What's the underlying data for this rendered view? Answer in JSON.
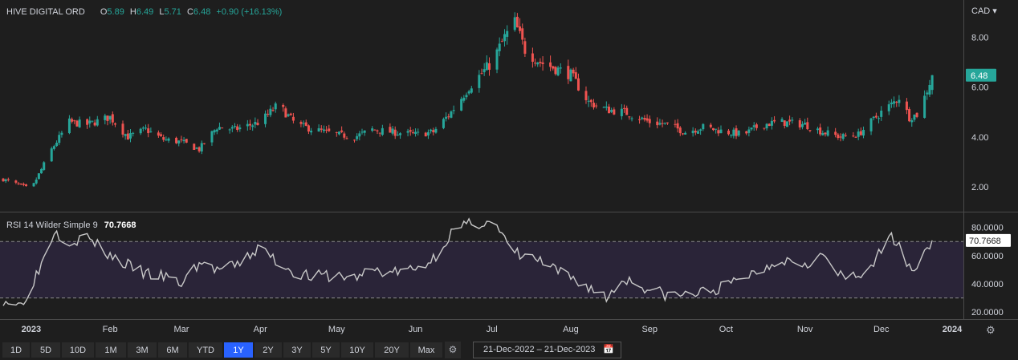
{
  "header": {
    "name": "HIVE DIGITAL ORD",
    "o_label": "O",
    "o_value": "5.89",
    "h_label": "H",
    "h_value": "6.49",
    "l_label": "L",
    "l_value": "5.71",
    "c_label": "C",
    "c_value": "6.48",
    "change": "+0.90 (+16.13%)"
  },
  "currency": "CAD",
  "rsi_header": {
    "label": "RSI 14 Wilder Simple 9",
    "value": "70.7668"
  },
  "colors": {
    "up": "#26a69a",
    "down": "#ef5350",
    "background": "#1e1e1e",
    "rsi_line": "#c8c8c8",
    "accent": "#2962ff"
  },
  "ranges": [
    "1D",
    "5D",
    "10D",
    "1M",
    "3M",
    "6M",
    "YTD",
    "1Y",
    "2Y",
    "3Y",
    "5Y",
    "10Y",
    "20Y",
    "Max"
  ],
  "active_range": "1Y",
  "date_range": "21-Dec-2022  –  21-Dec-2023",
  "icons": {
    "settings": "gear-icon",
    "calendar": "calendar-icon",
    "dropdown": "chevron-down-icon"
  },
  "chart_data": [
    {
      "type": "candlestick",
      "title": "HIVE DIGITAL ORD",
      "x_tick_labels": [
        "2023",
        "Feb",
        "Mar",
        "Apr",
        "May",
        "Jun",
        "Jul",
        "Aug",
        "Sep",
        "Oct",
        "Nov",
        "Dec",
        "2024"
      ],
      "y_tick_labels": [
        "2.00",
        "4.00",
        "6.00",
        "8.00"
      ],
      "ylim": [
        1.0,
        9.5
      ],
      "last_price_label": "6.48",
      "grid": false,
      "x": [
        "2022-12-21",
        "2023-01-01",
        "2023-01-09",
        "2023-01-16",
        "2023-01-23",
        "2023-02-01",
        "2023-02-08",
        "2023-02-15",
        "2023-02-22",
        "2023-03-01",
        "2023-03-08",
        "2023-03-15",
        "2023-03-22",
        "2023-04-01",
        "2023-04-08",
        "2023-04-15",
        "2023-04-22",
        "2023-05-01",
        "2023-05-08",
        "2023-05-15",
        "2023-05-22",
        "2023-06-01",
        "2023-06-08",
        "2023-06-15",
        "2023-06-22",
        "2023-07-01",
        "2023-07-06",
        "2023-07-10",
        "2023-07-14",
        "2023-07-20",
        "2023-08-01",
        "2023-08-08",
        "2023-08-15",
        "2023-08-22",
        "2023-09-01",
        "2023-09-08",
        "2023-09-15",
        "2023-09-22",
        "2023-10-01",
        "2023-10-08",
        "2023-10-15",
        "2023-10-22",
        "2023-11-01",
        "2023-11-08",
        "2023-11-15",
        "2023-11-22",
        "2023-12-01",
        "2023-12-05",
        "2023-12-08",
        "2023-12-12",
        "2023-12-15",
        "2023-12-18",
        "2023-12-21"
      ],
      "close": [
        2.3,
        1.9,
        3.5,
        4.6,
        4.5,
        4.8,
        4.0,
        4.3,
        3.9,
        3.8,
        3.5,
        4.4,
        4.3,
        4.6,
        5.3,
        4.5,
        4.3,
        4.1,
        4.0,
        4.3,
        4.2,
        4.1,
        4.2,
        5.0,
        6.0,
        7.0,
        8.0,
        8.6,
        7.5,
        7.0,
        6.5,
        5.4,
        5.1,
        5.0,
        4.6,
        4.5,
        4.2,
        4.4,
        4.2,
        4.1,
        4.5,
        4.6,
        4.5,
        4.2,
        4.0,
        4.1,
        5.0,
        5.3,
        5.6,
        4.8,
        4.9,
        5.6,
        6.48
      ]
    },
    {
      "type": "line",
      "title": "RSI 14 Wilder Simple 9",
      "series": [
        {
          "name": "RSI 14 Wilder Simple 9"
        }
      ],
      "y_tick_labels": [
        "20.0000",
        "40.0000",
        "60.0000",
        "80.0000"
      ],
      "ylim": [
        15,
        90
      ],
      "bands": [
        30,
        70
      ],
      "last_value_label": "70.7668",
      "x": [
        "2022-12-21",
        "2022-12-28",
        "2023-01-04",
        "2023-01-10",
        "2023-01-16",
        "2023-01-23",
        "2023-02-01",
        "2023-02-08",
        "2023-02-15",
        "2023-02-22",
        "2023-03-01",
        "2023-03-08",
        "2023-03-15",
        "2023-03-22",
        "2023-04-01",
        "2023-04-08",
        "2023-04-15",
        "2023-04-22",
        "2023-05-01",
        "2023-05-08",
        "2023-05-15",
        "2023-05-22",
        "2023-06-01",
        "2023-06-08",
        "2023-06-15",
        "2023-06-22",
        "2023-07-01",
        "2023-07-08",
        "2023-07-12",
        "2023-07-18",
        "2023-07-25",
        "2023-08-01",
        "2023-08-08",
        "2023-08-15",
        "2023-08-22",
        "2023-09-01",
        "2023-09-08",
        "2023-09-15",
        "2023-09-22",
        "2023-10-01",
        "2023-10-08",
        "2023-10-15",
        "2023-10-22",
        "2023-11-01",
        "2023-11-08",
        "2023-11-15",
        "2023-11-22",
        "2023-12-01",
        "2023-12-05",
        "2023-12-08",
        "2023-12-12",
        "2023-12-15",
        "2023-12-21"
      ],
      "values": [
        29,
        25,
        50,
        78,
        70,
        73,
        60,
        53,
        47,
        45,
        40,
        55,
        50,
        52,
        66,
        55,
        48,
        45,
        46,
        44,
        50,
        48,
        50,
        58,
        76,
        82,
        85,
        65,
        60,
        58,
        50,
        44,
        38,
        30,
        44,
        36,
        32,
        32,
        34,
        38,
        45,
        50,
        58,
        55,
        60,
        45,
        44,
        62,
        73,
        71,
        50,
        55,
        70.77
      ]
    }
  ]
}
